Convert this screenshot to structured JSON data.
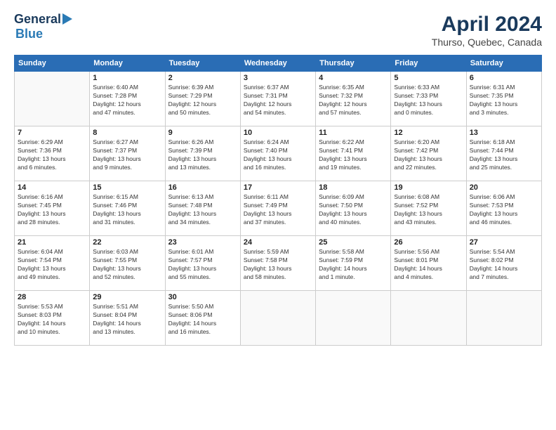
{
  "header": {
    "logo_general": "General",
    "logo_blue": "Blue",
    "month_title": "April 2024",
    "subtitle": "Thurso, Quebec, Canada"
  },
  "days_of_week": [
    "Sunday",
    "Monday",
    "Tuesday",
    "Wednesday",
    "Thursday",
    "Friday",
    "Saturday"
  ],
  "weeks": [
    [
      {
        "day": "",
        "info": ""
      },
      {
        "day": "1",
        "info": "Sunrise: 6:40 AM\nSunset: 7:28 PM\nDaylight: 12 hours\nand 47 minutes."
      },
      {
        "day": "2",
        "info": "Sunrise: 6:39 AM\nSunset: 7:29 PM\nDaylight: 12 hours\nand 50 minutes."
      },
      {
        "day": "3",
        "info": "Sunrise: 6:37 AM\nSunset: 7:31 PM\nDaylight: 12 hours\nand 54 minutes."
      },
      {
        "day": "4",
        "info": "Sunrise: 6:35 AM\nSunset: 7:32 PM\nDaylight: 12 hours\nand 57 minutes."
      },
      {
        "day": "5",
        "info": "Sunrise: 6:33 AM\nSunset: 7:33 PM\nDaylight: 13 hours\nand 0 minutes."
      },
      {
        "day": "6",
        "info": "Sunrise: 6:31 AM\nSunset: 7:35 PM\nDaylight: 13 hours\nand 3 minutes."
      }
    ],
    [
      {
        "day": "7",
        "info": "Sunrise: 6:29 AM\nSunset: 7:36 PM\nDaylight: 13 hours\nand 6 minutes."
      },
      {
        "day": "8",
        "info": "Sunrise: 6:27 AM\nSunset: 7:37 PM\nDaylight: 13 hours\nand 9 minutes."
      },
      {
        "day": "9",
        "info": "Sunrise: 6:26 AM\nSunset: 7:39 PM\nDaylight: 13 hours\nand 13 minutes."
      },
      {
        "day": "10",
        "info": "Sunrise: 6:24 AM\nSunset: 7:40 PM\nDaylight: 13 hours\nand 16 minutes."
      },
      {
        "day": "11",
        "info": "Sunrise: 6:22 AM\nSunset: 7:41 PM\nDaylight: 13 hours\nand 19 minutes."
      },
      {
        "day": "12",
        "info": "Sunrise: 6:20 AM\nSunset: 7:42 PM\nDaylight: 13 hours\nand 22 minutes."
      },
      {
        "day": "13",
        "info": "Sunrise: 6:18 AM\nSunset: 7:44 PM\nDaylight: 13 hours\nand 25 minutes."
      }
    ],
    [
      {
        "day": "14",
        "info": "Sunrise: 6:16 AM\nSunset: 7:45 PM\nDaylight: 13 hours\nand 28 minutes."
      },
      {
        "day": "15",
        "info": "Sunrise: 6:15 AM\nSunset: 7:46 PM\nDaylight: 13 hours\nand 31 minutes."
      },
      {
        "day": "16",
        "info": "Sunrise: 6:13 AM\nSunset: 7:48 PM\nDaylight: 13 hours\nand 34 minutes."
      },
      {
        "day": "17",
        "info": "Sunrise: 6:11 AM\nSunset: 7:49 PM\nDaylight: 13 hours\nand 37 minutes."
      },
      {
        "day": "18",
        "info": "Sunrise: 6:09 AM\nSunset: 7:50 PM\nDaylight: 13 hours\nand 40 minutes."
      },
      {
        "day": "19",
        "info": "Sunrise: 6:08 AM\nSunset: 7:52 PM\nDaylight: 13 hours\nand 43 minutes."
      },
      {
        "day": "20",
        "info": "Sunrise: 6:06 AM\nSunset: 7:53 PM\nDaylight: 13 hours\nand 46 minutes."
      }
    ],
    [
      {
        "day": "21",
        "info": "Sunrise: 6:04 AM\nSunset: 7:54 PM\nDaylight: 13 hours\nand 49 minutes."
      },
      {
        "day": "22",
        "info": "Sunrise: 6:03 AM\nSunset: 7:55 PM\nDaylight: 13 hours\nand 52 minutes."
      },
      {
        "day": "23",
        "info": "Sunrise: 6:01 AM\nSunset: 7:57 PM\nDaylight: 13 hours\nand 55 minutes."
      },
      {
        "day": "24",
        "info": "Sunrise: 5:59 AM\nSunset: 7:58 PM\nDaylight: 13 hours\nand 58 minutes."
      },
      {
        "day": "25",
        "info": "Sunrise: 5:58 AM\nSunset: 7:59 PM\nDaylight: 14 hours\nand 1 minute."
      },
      {
        "day": "26",
        "info": "Sunrise: 5:56 AM\nSunset: 8:01 PM\nDaylight: 14 hours\nand 4 minutes."
      },
      {
        "day": "27",
        "info": "Sunrise: 5:54 AM\nSunset: 8:02 PM\nDaylight: 14 hours\nand 7 minutes."
      }
    ],
    [
      {
        "day": "28",
        "info": "Sunrise: 5:53 AM\nSunset: 8:03 PM\nDaylight: 14 hours\nand 10 minutes."
      },
      {
        "day": "29",
        "info": "Sunrise: 5:51 AM\nSunset: 8:04 PM\nDaylight: 14 hours\nand 13 minutes."
      },
      {
        "day": "30",
        "info": "Sunrise: 5:50 AM\nSunset: 8:06 PM\nDaylight: 14 hours\nand 16 minutes."
      },
      {
        "day": "",
        "info": ""
      },
      {
        "day": "",
        "info": ""
      },
      {
        "day": "",
        "info": ""
      },
      {
        "day": "",
        "info": ""
      }
    ]
  ]
}
